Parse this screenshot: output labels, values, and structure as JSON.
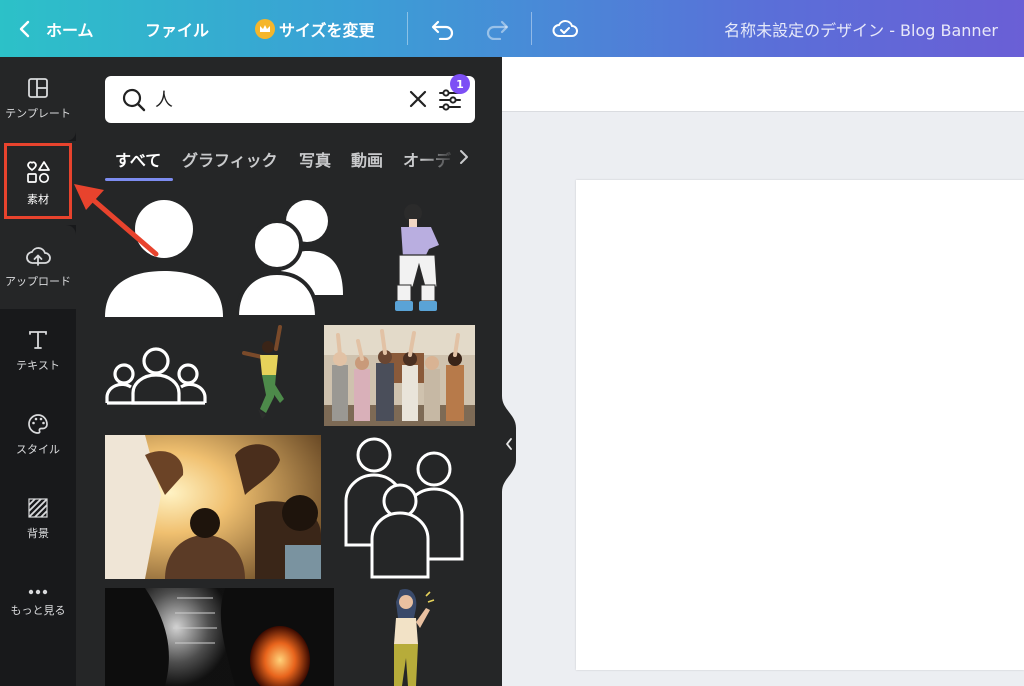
{
  "topbar": {
    "home_label": "ホーム",
    "file_label": "ファイル",
    "resize_label": "サイズを変更",
    "doc_title": "名称未設定のデザイン - Blog Banner"
  },
  "rail": {
    "items": [
      {
        "label": "テンプレート",
        "icon": "template-icon"
      },
      {
        "label": "素材",
        "icon": "elements-icon"
      },
      {
        "label": "アップロード",
        "icon": "upload-cloud-icon"
      },
      {
        "label": "テキスト",
        "icon": "text-icon"
      },
      {
        "label": "スタイル",
        "icon": "palette-icon"
      },
      {
        "label": "背景",
        "icon": "background-pattern-icon"
      },
      {
        "label": "もっと見る",
        "icon": "more-dots-icon"
      }
    ]
  },
  "search": {
    "value": "人",
    "filter_count": "1"
  },
  "tabs": [
    {
      "label": "すべて"
    },
    {
      "label": "グラフィック"
    },
    {
      "label": "写真"
    },
    {
      "label": "動画"
    },
    {
      "label": "オーデ"
    }
  ],
  "colors": {
    "accent": "#7d4ff5",
    "highlight": "#e8432d",
    "panel_bg": "#252627",
    "rail_bg": "#18191b"
  }
}
